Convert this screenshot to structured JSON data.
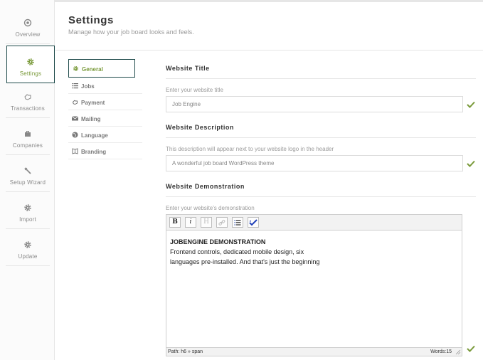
{
  "nav": {
    "items": [
      {
        "label": "Overview",
        "icon": "overview-icon"
      },
      {
        "label": "Settings",
        "icon": "gear-icon"
      },
      {
        "label": "Transactions",
        "icon": "hand-icon"
      },
      {
        "label": "Companies",
        "icon": "briefcase-icon"
      },
      {
        "label": "Setup Wizard",
        "icon": "wand-icon"
      },
      {
        "label": "Import",
        "icon": "gear-icon"
      },
      {
        "label": "Update",
        "icon": "gear-icon"
      }
    ]
  },
  "header": {
    "title": "Settings",
    "subtitle": "Manage how your job board looks and feels."
  },
  "submenu": {
    "items": [
      {
        "label": "General",
        "icon": "gear-icon"
      },
      {
        "label": "Jobs",
        "icon": "list-icon"
      },
      {
        "label": "Payment",
        "icon": "hand-icon"
      },
      {
        "label": "Mailing",
        "icon": "mail-icon"
      },
      {
        "label": "Language",
        "icon": "globe-icon"
      },
      {
        "label": "Branding",
        "icon": "book-icon"
      }
    ]
  },
  "website_title": {
    "heading": "Website Title",
    "label": "Enter your website title",
    "value": "Job Engine"
  },
  "website_description": {
    "heading": "Website Description",
    "label": "This description will appear next to your website logo in the header",
    "value": "A wonderful job board WordPress theme"
  },
  "website_demonstration": {
    "heading": "Website Demonstration",
    "label": "Enter your website's demonstration",
    "toolbar": {
      "bold": "B",
      "italic": "i",
      "heading": "H"
    },
    "content_heading": "JOBENGINE DEMONSTRATION",
    "content_line1": "Frontend controls, dedicated mobile design, six",
    "content_line2": "languages pre-installed. And that's just the beginning",
    "status_path": "Path: h6 » span",
    "status_words": "Words:15"
  },
  "colors": {
    "accent": "#7a9a3a",
    "active_border": "#1e4a4a",
    "check": "#7a9a3a"
  }
}
